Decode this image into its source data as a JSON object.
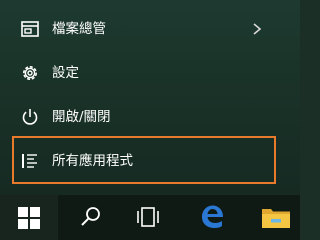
{
  "menu": {
    "items": [
      {
        "label": "檔案總管",
        "icon": "folder-explorer-icon",
        "has_submenu": true
      },
      {
        "label": "設定",
        "icon": "gear-icon"
      },
      {
        "label": "開啟/關閉",
        "icon": "power-icon"
      },
      {
        "label": "所有應用程式",
        "icon": "list-icon"
      }
    ]
  },
  "taskbar": {
    "buttons": [
      {
        "name": "start",
        "icon": "windows-logo-icon"
      },
      {
        "name": "search",
        "icon": "search-icon"
      },
      {
        "name": "task-view",
        "icon": "task-view-icon"
      },
      {
        "name": "edge",
        "icon": "edge-browser-icon"
      },
      {
        "name": "file-explorer",
        "icon": "folder-icon"
      }
    ]
  },
  "colors": {
    "highlight": "#e87a2c",
    "edge_blue": "#2a78d4",
    "folder_yellow": "#f4c542",
    "menu_background": "#1a3329",
    "taskbar_background": "#0f1a15"
  }
}
